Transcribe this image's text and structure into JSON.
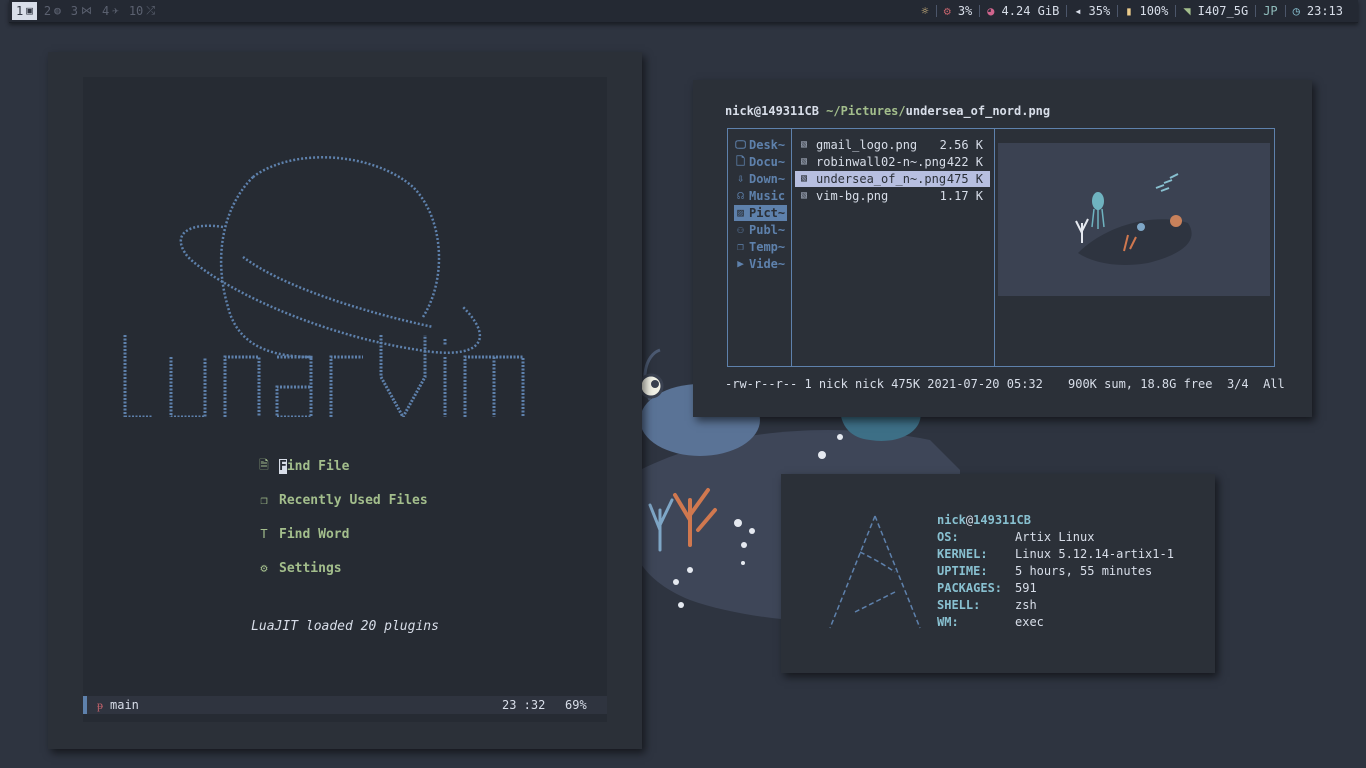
{
  "bar": {
    "workspaces": [
      {
        "num": "1",
        "icon": "terminal-icon",
        "glyph": "▣",
        "active": true
      },
      {
        "num": "2",
        "icon": "globe-icon",
        "glyph": "◍",
        "active": false
      },
      {
        "num": "3",
        "icon": "vscode-icon",
        "glyph": "⋈",
        "active": false
      },
      {
        "num": "4",
        "icon": "airplane-icon",
        "glyph": "✈",
        "active": false
      },
      {
        "num": "10",
        "icon": "shuffle-icon",
        "glyph": "⤮",
        "active": false
      }
    ],
    "cpu": "3%",
    "memory": "4.24 GiB",
    "volume": "35%",
    "battery": "100%",
    "wifi": "I407_5G",
    "layout": "JP",
    "clock": "23:13"
  },
  "lvim": {
    "dashboard": [
      {
        "icon": "file-icon",
        "glyph": "🗎",
        "first": "F",
        "rest": "ind File"
      },
      {
        "icon": "recent-files-icon",
        "glyph": "❐",
        "first": "",
        "rest": "Recently Used Files"
      },
      {
        "icon": "find-word-icon",
        "glyph": "T",
        "first": "",
        "rest": "Find Word"
      },
      {
        "icon": "settings-gear-icon",
        "glyph": "⚙",
        "first": "",
        "rest": "Settings"
      }
    ],
    "footer": "LuaJIT loaded 20 plugins",
    "status": {
      "branch": "main",
      "position": "23 :32",
      "percent": "69%"
    }
  },
  "lf": {
    "header": {
      "user": "nick@149311CB",
      "path": "~/Pictures/",
      "file": "undersea_of_nord.png"
    },
    "dirs": [
      {
        "name": "Desk~",
        "icon": "desktop-icon",
        "glyph": "🖵",
        "selected": false
      },
      {
        "name": "Docu~",
        "icon": "document-icon",
        "glyph": "🗋",
        "selected": false
      },
      {
        "name": "Down~",
        "icon": "download-icon",
        "glyph": "⇩",
        "selected": false
      },
      {
        "name": "Music",
        "icon": "headphones-icon",
        "glyph": "☊",
        "selected": false
      },
      {
        "name": "Pict~",
        "icon": "picture-icon",
        "glyph": "▨",
        "selected": true
      },
      {
        "name": "Publ~",
        "icon": "users-icon",
        "glyph": "⚇",
        "selected": false
      },
      {
        "name": "Temp~",
        "icon": "template-icon",
        "glyph": "❐",
        "selected": false
      },
      {
        "name": "Vide~",
        "icon": "video-icon",
        "glyph": "▶",
        "selected": false
      }
    ],
    "files": [
      {
        "name": "gmail_logo.png",
        "size": "2.56 K",
        "selected": false
      },
      {
        "name": "robinwall02-n~.png",
        "size": "422 K",
        "selected": false
      },
      {
        "name": "undersea_of_n~.png",
        "size": "475 K",
        "selected": true
      },
      {
        "name": "vim-bg.png",
        "size": "1.17 K",
        "selected": false
      }
    ],
    "footer_left": "-rw-r--r-- 1 nick nick 475K 2021-07-20 05:32",
    "footer_right": "900K sum, 18.8G free  3/4  All"
  },
  "neofetch": {
    "user": "nick",
    "host": "149311CB",
    "rows": [
      {
        "key": "OS:",
        "value": "Artix Linux"
      },
      {
        "key": "KERNEL:",
        "value": "Linux 5.12.14-artix1-1"
      },
      {
        "key": "UPTIME:",
        "value": "5 hours, 55 minutes"
      },
      {
        "key": "PACKAGES:",
        "value": "591"
      },
      {
        "key": "SHELL:",
        "value": "zsh"
      },
      {
        "key": "WM:",
        "value": "exec"
      }
    ]
  },
  "colors": {
    "background": "#2e3440",
    "accent_blue": "#5e81ac",
    "accent_cyan": "#88c0d0",
    "accent_green": "#a3be8c",
    "accent_red": "#bf616a"
  }
}
